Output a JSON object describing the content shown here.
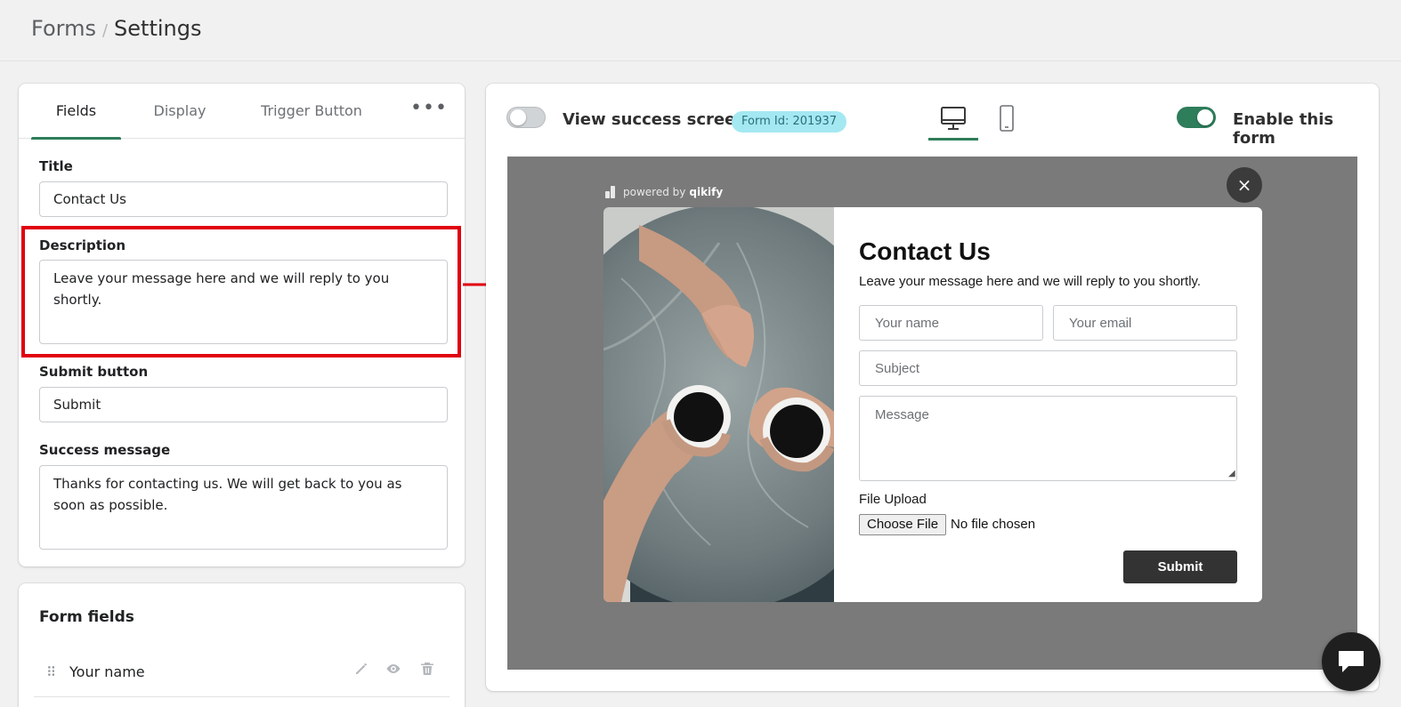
{
  "breadcrumb": {
    "parent": "Forms",
    "separator": "/",
    "current": "Settings"
  },
  "tabs": [
    {
      "label": "Fields",
      "active": true
    },
    {
      "label": "Display",
      "active": false
    },
    {
      "label": "Trigger Button",
      "active": false
    }
  ],
  "settings": {
    "title_label": "Title",
    "title_value": "Contact Us",
    "description_label": "Description",
    "description_value": "Leave your message here and we will reply to you shortly.",
    "submit_label": "Submit button",
    "submit_value": "Submit",
    "success_label": "Success message",
    "success_value": "Thanks for contacting us. We will get back to you as soon as possible."
  },
  "form_fields": {
    "heading": "Form fields",
    "rows": [
      {
        "label": "Your name"
      }
    ]
  },
  "preview_header": {
    "view_success_label": "View success screen",
    "view_success_on": false,
    "form_id_badge": "Form Id: 201937",
    "enable_label": "Enable this form",
    "enable_on": true,
    "active_device": "desktop"
  },
  "preview": {
    "powered_text": "powered by",
    "powered_brand": "qikify",
    "close_icon": "×",
    "title": "Contact Us",
    "description": "Leave your message here and we will reply to you shortly.",
    "name_placeholder": "Your name",
    "email_placeholder": "Your email",
    "subject_placeholder": "Subject",
    "message_placeholder": "Message",
    "upload_label": "File Upload",
    "choose_file": "Choose File",
    "no_file": "No file chosen",
    "submit": "Submit"
  },
  "colors": {
    "accent": "#2e7d5b",
    "highlight": "#e1000f",
    "badge_bg": "#a4e8f2",
    "preview_bg": "#7a7a7a",
    "submit_bg": "#333333"
  }
}
